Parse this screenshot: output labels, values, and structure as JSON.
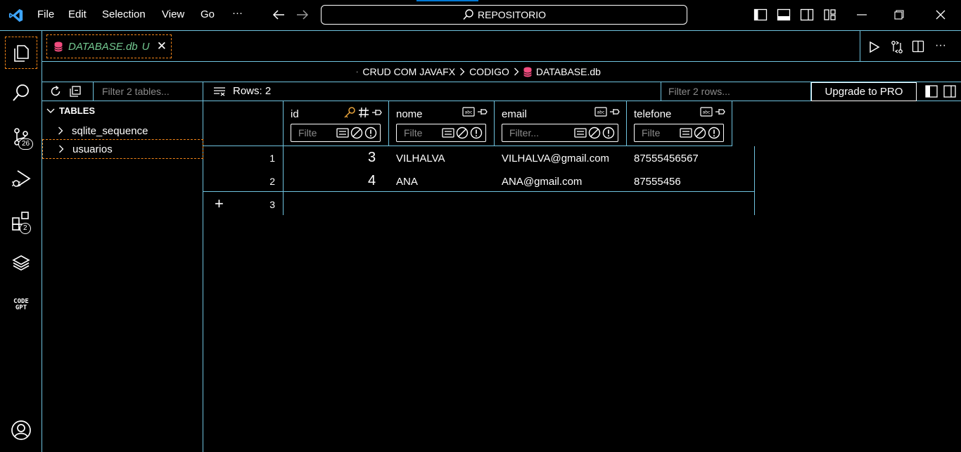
{
  "titlebar": {
    "menu": [
      "File",
      "Edit",
      "Selection",
      "View",
      "Go",
      "···"
    ],
    "search_text": "REPOSITORIO"
  },
  "activity": {
    "source_control_badge": "26",
    "extensions_badge": "2",
    "codegpt_label_line1": "CODE",
    "codegpt_label_line2": "GPT"
  },
  "tab": {
    "title": "DATABASE.db",
    "status": "U",
    "close": "✕"
  },
  "breadcrumb": {
    "items": [
      "CRUD COM JAVAFX",
      "CODIGO",
      "DATABASE.db"
    ]
  },
  "sidebar": {
    "filter_placeholder": "Filter 2 tables...",
    "section_title": "TABLES",
    "tables": [
      "sqlite_sequence",
      "usuarios"
    ]
  },
  "grid_toolbar": {
    "rows_label": "Rows: 2",
    "filter_placeholder": "Filter 2 rows...",
    "upgrade_label": "Upgrade to PRO"
  },
  "columns": [
    {
      "name": "id",
      "filter_placeholder": "Filte"
    },
    {
      "name": "nome",
      "filter_placeholder": "Filte"
    },
    {
      "name": "email",
      "filter_placeholder": "Filter..."
    },
    {
      "name": "telefone",
      "filter_placeholder": "Filte"
    }
  ],
  "rows": [
    {
      "num": "1",
      "id": "3",
      "nome": "VILHALVA",
      "email": "VILHALVA@gmail.com",
      "telefone": "87555456567"
    },
    {
      "num": "2",
      "id": "4",
      "nome": "ANA",
      "email": "ANA@gmail.com",
      "telefone": "87555456"
    }
  ],
  "new_row": {
    "add_icon": "+",
    "num": "3"
  },
  "colors": {
    "border": "#6fc3df",
    "focus": "#f38518",
    "untracked": "#73c991",
    "db_icon": "#f14c7f"
  }
}
